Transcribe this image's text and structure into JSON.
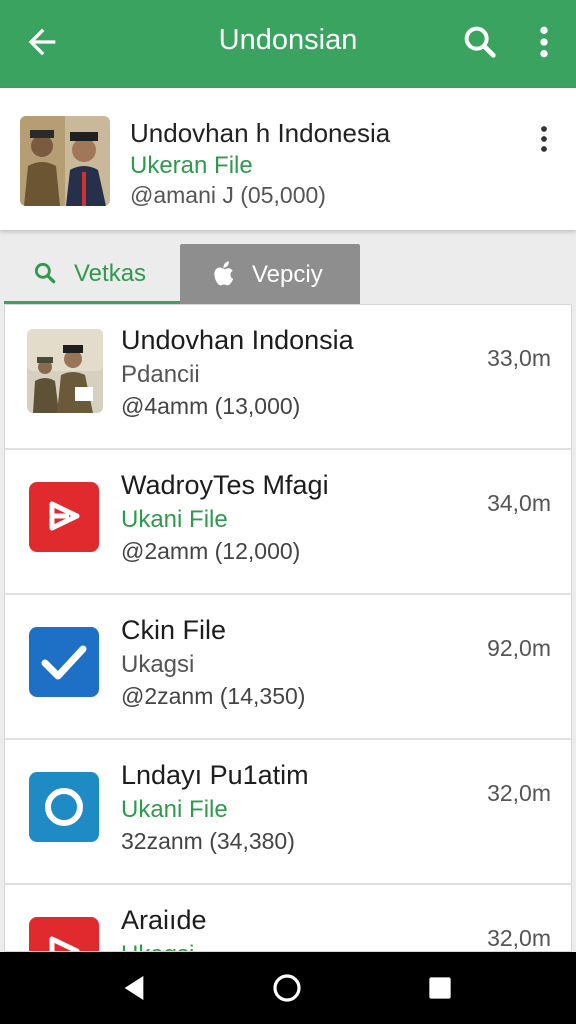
{
  "appbar": {
    "title": "Undonsian"
  },
  "header": {
    "name": "Undovhan h Indonesia",
    "subtitle": "Ukeran File",
    "meta": "@amani J (05,000)"
  },
  "tabs": [
    {
      "label": "Vetkas",
      "icon": "search-icon",
      "active": true
    },
    {
      "label": "Vepciy",
      "icon": "apple-icon",
      "active": false
    }
  ],
  "list": [
    {
      "title": "Undovhan Indonsia",
      "subtitle": "Pdancii",
      "subtitle_color": "gray",
      "meta": "@4amm (13,000)",
      "size": "33,0m",
      "icon": "photo-icon"
    },
    {
      "title": "WadroyTes Mfagi",
      "subtitle": "Ukani File",
      "subtitle_color": "green",
      "meta": "@2amm (12,000)",
      "size": "34,0m",
      "icon": "red-play-icon"
    },
    {
      "title": "Ckin File",
      "subtitle": "Ukagsi",
      "subtitle_color": "gray",
      "meta": "@2zanm (14,350)",
      "size": "92,0m",
      "icon": "blue-check-icon"
    },
    {
      "title": "Lndayı Pu1atim",
      "subtitle": "Ukani File",
      "subtitle_color": "green",
      "meta": "32zanm (34,380)",
      "size": "32,0m",
      "icon": "blue-circle-icon"
    },
    {
      "title": "Araiıde",
      "subtitle": "Ukagsi",
      "subtitle_color": "green",
      "meta": "",
      "size": "32,0m",
      "icon": "red-play-icon"
    }
  ],
  "colors": {
    "primary": "#3aa35f",
    "accent_green": "#2f9a4e",
    "tab_inactive": "#8e8e8e"
  }
}
